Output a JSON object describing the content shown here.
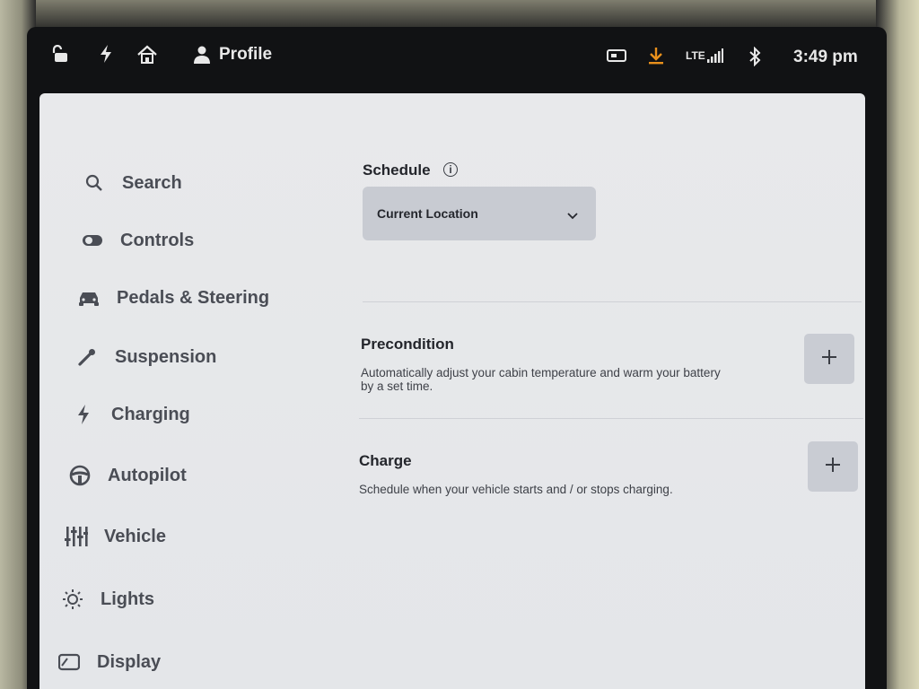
{
  "status_bar": {
    "profile_label": "Profile",
    "network_label": "LTE",
    "time": "3:49 pm",
    "icons": [
      "lock-open-icon",
      "bolt-icon",
      "homelink-icon",
      "person-icon",
      "dashcam-icon",
      "download-icon",
      "signal-icon",
      "bluetooth-icon"
    ],
    "download_color": "#e8901c"
  },
  "sidebar": {
    "items": [
      {
        "label": "Search",
        "icon": "search-icon"
      },
      {
        "label": "Controls",
        "icon": "toggle-icon"
      },
      {
        "label": "Pedals & Steering",
        "icon": "car-icon"
      },
      {
        "label": "Suspension",
        "icon": "wrench-icon"
      },
      {
        "label": "Charging",
        "icon": "bolt-icon"
      },
      {
        "label": "Autopilot",
        "icon": "steering-wheel-icon"
      },
      {
        "label": "Vehicle",
        "icon": "sliders-icon"
      },
      {
        "label": "Lights",
        "icon": "sun-icon"
      },
      {
        "label": "Display",
        "icon": "display-icon"
      }
    ]
  },
  "main": {
    "schedule_title": "Schedule",
    "location_dropdown": {
      "selected": "Current Location"
    },
    "precondition": {
      "title": "Precondition",
      "description_line1": "Automatically adjust your cabin temperature and warm your battery",
      "description_line2": "by a set time."
    },
    "charge": {
      "title": "Charge",
      "description": "Schedule when your vehicle starts and / or stops charging."
    }
  }
}
